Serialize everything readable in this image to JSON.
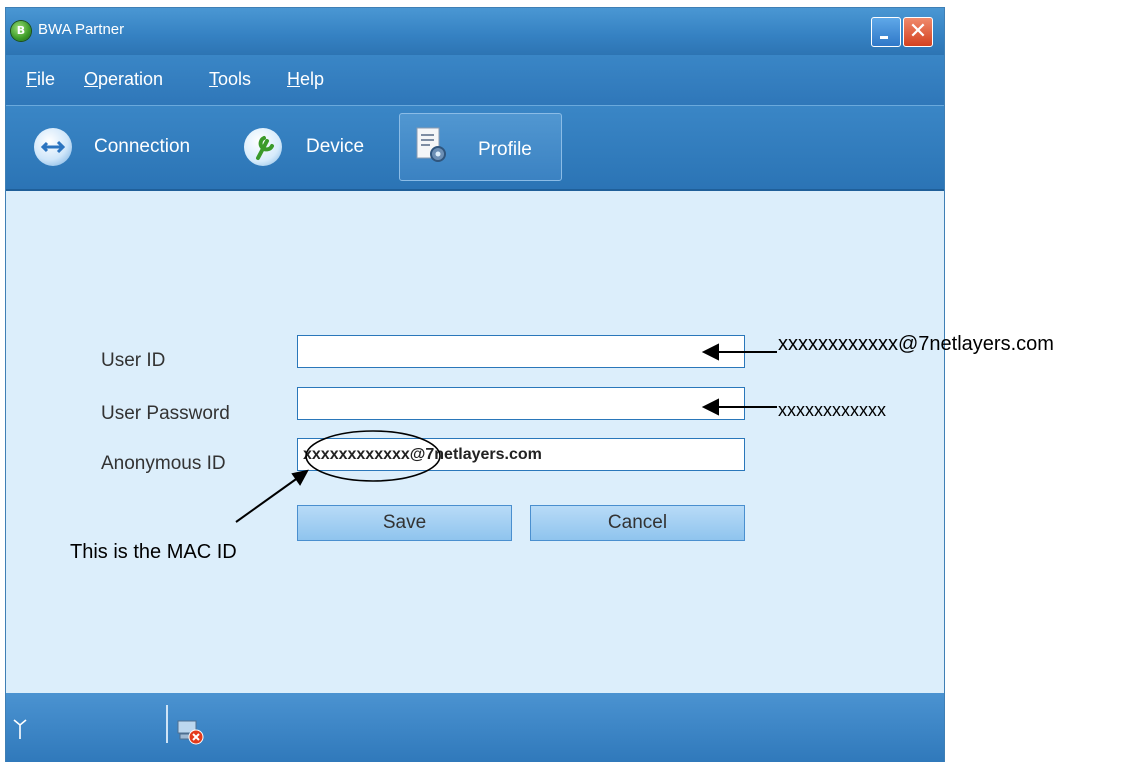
{
  "window": {
    "title": "BWA Partner"
  },
  "menu": {
    "file": "File",
    "operation": "Operation",
    "tools": "Tools",
    "help": "Help"
  },
  "toolbar": {
    "connection": "Connection",
    "device": "Device",
    "profile": "Profile"
  },
  "form": {
    "user_id_label": "User ID",
    "user_password_label": "User Password",
    "anonymous_id_label": "Anonymous ID",
    "user_id_value": "",
    "user_password_value": "",
    "anonymous_id_value": "xxxxxxxxxxxx@7netlayers.com",
    "save_label": "Save",
    "cancel_label": "Cancel"
  },
  "annotations": {
    "user_id_note": "xxxxxxxxxxxx@7netlayers.com",
    "password_note": "xxxxxxxxxxxx",
    "mac_note": "This is the MAC ID"
  },
  "colors": {
    "window_blue": "#3581c2",
    "content_bg": "#dceefb",
    "close_red": "#d4411f"
  }
}
